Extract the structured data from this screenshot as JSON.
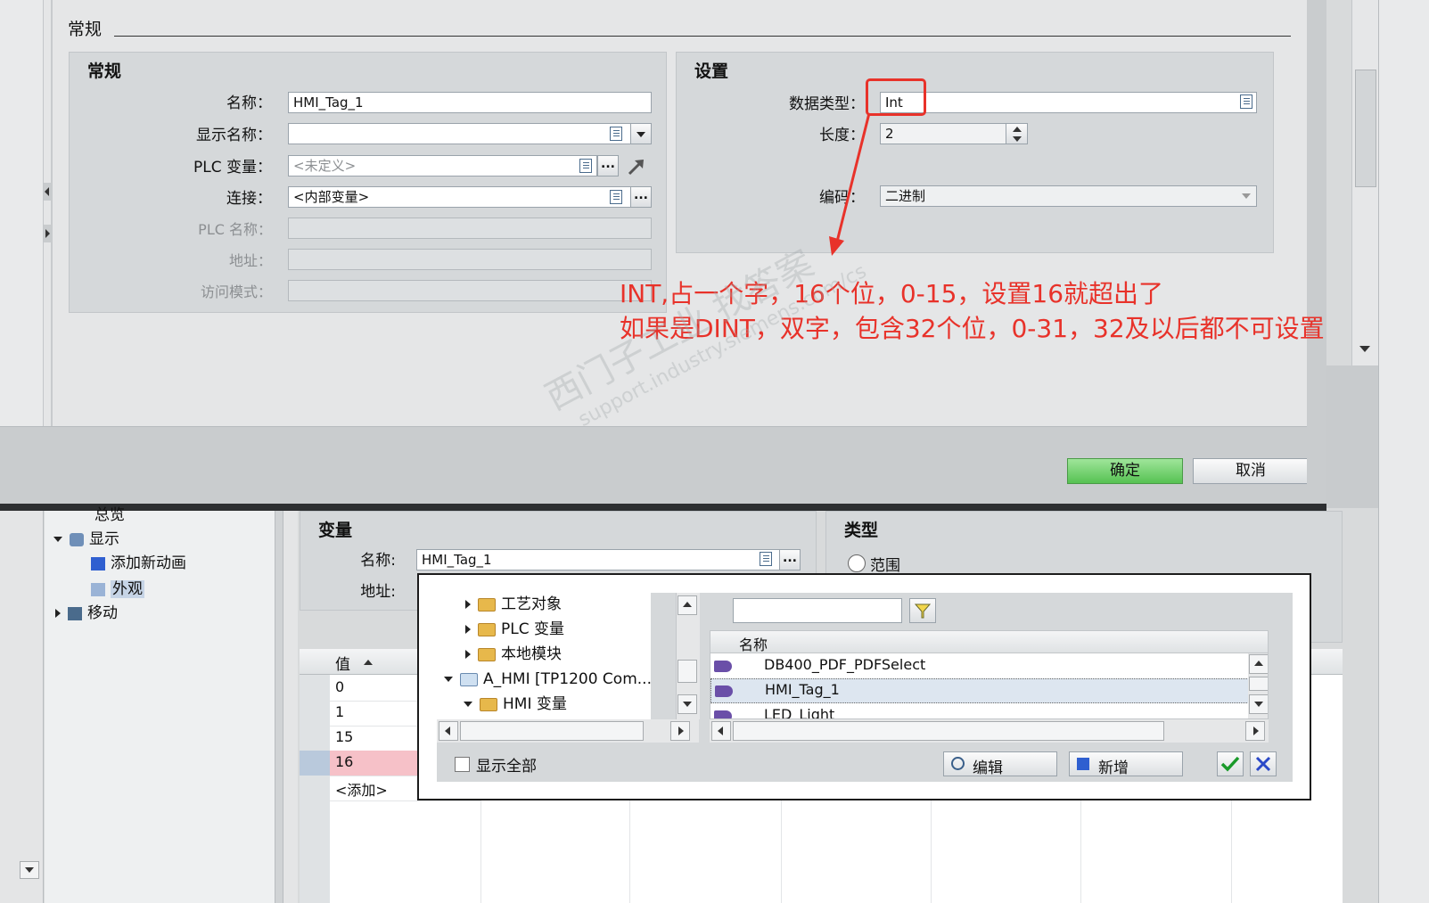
{
  "general_section": {
    "title": "常规"
  },
  "general_panel": {
    "title": "常规",
    "name_label": "名称：",
    "name_value": "HMI_Tag_1",
    "display_name_label": "显示名称：",
    "display_name_value": "",
    "plc_tag_label": "PLC 变量：",
    "plc_tag_value": "<未定义>",
    "connection_label": "连接：",
    "connection_value": "<内部变量>",
    "plc_name_label": "PLC 名称：",
    "address_label": "地址：",
    "access_mode_label": "访问模式："
  },
  "settings_panel": {
    "title": "设置",
    "datatype_label": "数据类型：",
    "datatype_value": "Int",
    "length_label": "长度：",
    "length_value": "2",
    "encoding_label": "编码：",
    "encoding_value": "二进制"
  },
  "annotation": {
    "line1": "INT,占一个字，16个位，0-15，设置16就超出了",
    "line2": "如果是DINT，双字，包含32个位，0-31，32及以后都不可设置",
    "color": "#e8322a"
  },
  "dialog_buttons": {
    "ok": "确定",
    "cancel": "取消"
  },
  "watermark": {
    "text": "西门子工业  找答案",
    "url": "support.industry.siemens.com/cs"
  },
  "left_tree": {
    "overview": "总览",
    "display": "显示",
    "add_animation": "添加新动画",
    "appearance": "外观",
    "movement": "移动"
  },
  "variable_panel": {
    "title": "变量",
    "name_label": "名称:",
    "name_value": "HMI_Tag_1",
    "address_label": "地址:"
  },
  "type_panel": {
    "title": "类型",
    "range_label": "范围"
  },
  "values_table": {
    "header": "值",
    "rows": [
      "0",
      "1",
      "15",
      "16",
      "<添加>"
    ],
    "highlight_color": "#f6c1c8"
  },
  "picker": {
    "tree": [
      "工艺对象",
      "PLC 变量",
      "本地模块",
      "A_HMI [TP1200 Com...",
      "HMI 变量"
    ],
    "search_value": "",
    "column_header": "名称",
    "items": [
      "DB400_PDF_PDFSelect",
      "HMI_Tag_1",
      "LED_Light"
    ],
    "show_all_label": "显示全部",
    "edit_label": "编辑",
    "add_label": "新增"
  }
}
